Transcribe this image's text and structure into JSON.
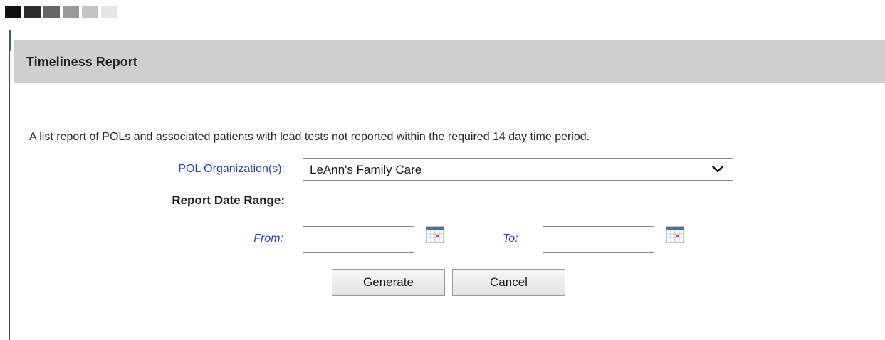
{
  "swatches": [
    "#111111",
    "#2b2b2b",
    "#666666",
    "#999999",
    "#c4c4c4",
    "#e6e6e6"
  ],
  "colors": {
    "header_bg": "#cfcfcf",
    "label_blue": "#2b3fc2",
    "left_accent_top": "#3a5a8c",
    "left_accent": "#8c2a3c"
  },
  "header": {
    "title": "Timeliness Report"
  },
  "description": "A list report of POLs and associated patients with lead tests not reported within the required 14 day time period.",
  "form": {
    "pol_label": "POL Organization(s):",
    "pol_selected": "LeAnn's Family Care",
    "date_range_label": "Report Date Range:",
    "from_label": "From:",
    "from_value": "",
    "to_label": "To:",
    "to_value": ""
  },
  "icons": {
    "dropdown": "chevron-down-icon",
    "calendar": "calendar-icon"
  },
  "buttons": {
    "generate": "Generate",
    "cancel": "Cancel"
  }
}
